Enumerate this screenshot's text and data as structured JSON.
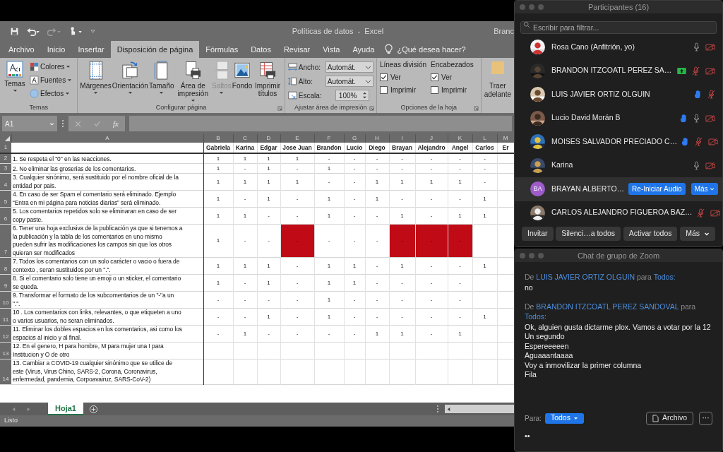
{
  "excel": {
    "title": "Políticas de datos  -  Excel",
    "user": "Branc",
    "tabs": [
      {
        "label": "Archivo",
        "selected": false
      },
      {
        "label": "Inicio",
        "selected": false
      },
      {
        "label": "Insertar",
        "selected": false
      },
      {
        "label": "Disposición de página",
        "selected": true
      },
      {
        "label": "Fórmulas",
        "selected": false
      },
      {
        "label": "Datos",
        "selected": false
      },
      {
        "label": "Revisar",
        "selected": false
      },
      {
        "label": "Vista",
        "selected": false
      },
      {
        "label": "Ayuda",
        "selected": false
      }
    ],
    "tell_me": "¿Qué desea hacer?",
    "ribbon": [
      {
        "kind": "themes",
        "label": "Temas",
        "big": "Temas",
        "items": [
          "Colores",
          "Fuentes",
          "Efectos"
        ]
      },
      {
        "kind": "buttons",
        "label": "Configurar página",
        "buttons": [
          {
            "label": "Márgenes",
            "dropdown": true,
            "disabled": false
          },
          {
            "label": "Orientación",
            "dropdown": true,
            "disabled": false
          },
          {
            "label": "Tamaño",
            "dropdown": true,
            "disabled": false
          },
          {
            "label": "Área de impresión",
            "dropdown": true,
            "disabled": false
          },
          {
            "label": "Saltos",
            "dropdown": true,
            "disabled": true
          },
          {
            "label": "Fondo",
            "dropdown": false,
            "disabled": false
          },
          {
            "label": "Imprimir títulos",
            "dropdown": false,
            "disabled": false
          }
        ]
      },
      {
        "kind": "scale",
        "label": "Ajustar área de impresión",
        "fields": [
          {
            "label": "Ancho:",
            "value": "Automát.",
            "kind": "dropdown"
          },
          {
            "label": "Alto:",
            "value": "Automát.",
            "kind": "dropdown"
          },
          {
            "label": "Escala:",
            "value": "100%",
            "kind": "spinner"
          }
        ]
      },
      {
        "kind": "options",
        "label": "Opciones de la hoja",
        "columns": [
          {
            "title": "Líneas división",
            "checks": [
              {
                "label": "Ver",
                "checked": true
              },
              {
                "label": "Imprimir",
                "checked": false
              }
            ]
          },
          {
            "title": "Encabezados",
            "checks": [
              {
                "label": "Ver",
                "checked": true
              },
              {
                "label": "Imprimir",
                "checked": false
              }
            ]
          }
        ]
      },
      {
        "kind": "single",
        "lines": [
          "Traer",
          "adelante"
        ]
      }
    ],
    "name_box": "A1",
    "formula_label": "fx",
    "table": {
      "corner_row": "1",
      "column_a": "A",
      "columns": [
        {
          "letter": "B",
          "name": "Gabriela"
        },
        {
          "letter": "C",
          "name": "Karina"
        },
        {
          "letter": "D",
          "name": "Edgar"
        },
        {
          "letter": "E",
          "name": "Jose Juan"
        },
        {
          "letter": "F",
          "name": "Brandon"
        },
        {
          "letter": "G",
          "name": "Lucio"
        },
        {
          "letter": "H",
          "name": "Diego"
        },
        {
          "letter": "I",
          "name": "Brayan"
        },
        {
          "letter": "J",
          "name": "Alejandro"
        },
        {
          "letter": "K",
          "name": "Angel"
        },
        {
          "letter": "L",
          "name": "Carlos"
        },
        {
          "letter": "M",
          "name": "Er"
        }
      ],
      "rows": [
        {
          "number": "2",
          "rule": [
            "1. Se respeta el \"0\" en las reacciones."
          ],
          "cells": [
            "1",
            "1",
            "1",
            "1",
            "-",
            "-",
            "-",
            "-",
            "-",
            "-",
            "-"
          ]
        },
        {
          "number": "3",
          "rule": [
            "2. No eliminar las groserias de los comentarios."
          ],
          "cells": [
            "1",
            "-",
            "1",
            "-",
            "1",
            "-",
            "-",
            "-",
            "-",
            "-",
            "-"
          ]
        },
        {
          "number": "4",
          "rule": [
            "3. Cualquier sinónimo, será sustituido por el nombre oficial de la",
            "entidad por pais."
          ],
          "cells": [
            "1",
            "1",
            "1",
            "1",
            "-",
            "-",
            "1",
            "1",
            "1",
            "1",
            "-"
          ]
        },
        {
          "number": "5",
          "rule": [
            "4. En caso de ser Spam el comentario será eliminado. Ejemplo",
            "“Entra en mi página para noticias diarias” será eliminado."
          ],
          "cells": [
            "1",
            "-",
            "1",
            "-",
            "1",
            "-",
            "1",
            "-",
            "-",
            "-",
            "1"
          ]
        },
        {
          "number": "6",
          "rule": [
            "5. Los comentarios repetidos solo se eliminaran en caso de ser",
            "copy paste."
          ],
          "cells": [
            "1",
            "1",
            "-",
            "-",
            "1",
            "-",
            "-",
            "1",
            "-",
            "1",
            "1"
          ]
        },
        {
          "number": "7",
          "rule": [
            "6. Tener una hoja exclusiva de la publicación ya que si tenemos a",
            "la publicación y la tabla de los comentarios en uno mismo",
            "pueden sufrir las modificaciones los campos sin que los otros",
            "quieran ser modificados"
          ],
          "cells": [
            "1",
            "-",
            "-",
            "-",
            "-",
            "-",
            "-",
            "-",
            "-",
            "-",
            null
          ],
          "highlighted": [
            false,
            false,
            false,
            true,
            false,
            false,
            false,
            true,
            true,
            true,
            false
          ]
        },
        {
          "number": "8",
          "rule": [
            "7. Todos los comentarios con un solo carácter o vacio o fuera de",
            "contexto , seran sustituidos por un \".\"."
          ],
          "cells": [
            "1",
            "1",
            "1",
            "-",
            "1",
            "1",
            "-",
            "1",
            "-",
            "-",
            "1"
          ]
        },
        {
          "number": "9",
          "rule": [
            "8. Si el comentario solo tiene un emoji o un sticker, el comentario",
            "se queda."
          ],
          "cells": [
            "1",
            "-",
            "1",
            "-",
            "1",
            "1",
            "-",
            "-",
            "-",
            "-",
            null
          ]
        },
        {
          "number": "10",
          "rule": [
            "9. Transformar el formato de los subcomentarios de un \"-\"a un",
            "\".\"."
          ],
          "cells": [
            "-",
            "-",
            "-",
            "-",
            "1",
            "-",
            "-",
            "-",
            "-",
            "-",
            null
          ]
        },
        {
          "number": "11",
          "rule": [
            "10 . Los comentarios con links, relevantes,  o que etiqueten a uno",
            "o varios  usuarios, no seran eliminados."
          ],
          "cells": [
            "-",
            "-",
            "1",
            "-",
            "1",
            "-",
            "-",
            "-",
            "-",
            "-",
            "1"
          ]
        },
        {
          "number": "12",
          "rule": [
            "11. Eliminar los dobles espacios en los comentarios, asi como los",
            "espacios al inicio y al final."
          ],
          "cells": [
            "-",
            "1",
            "-",
            "-",
            "-",
            "-",
            "1",
            "1",
            "-",
            "1",
            null
          ]
        },
        {
          "number": "13",
          "rule": [
            "12. En el genero, H para hombre, M para mujer una I para",
            "Institucion y O de otro"
          ]
        },
        {
          "number": "14",
          "rule": [
            "13. Cambiar a COVID-19 cualquier sinónimo que se utilice de",
            "este (Virus, Virus Chino, SARS-2, Corona, Coronavirus,",
            "enfermedad, pandemia, Corpoavairuz, SARS-CoV-2)"
          ]
        }
      ]
    },
    "sheets": [
      {
        "label": "Hoja1",
        "selected": true
      }
    ],
    "status": "Listo"
  },
  "participants": {
    "title": "Participantes (16)",
    "search": {
      "placeholder": "Escribir para filtrar..."
    },
    "items": [
      {
        "name": "Rosa Cano (Anfitrión, yo)",
        "sharing": false,
        "hand": false,
        "muted": false,
        "video_off": true,
        "selected": false
      },
      {
        "name": "BRANDON ITZCOATL PEREZ SA…",
        "sharing": true,
        "hand": false,
        "muted": true,
        "video_off": true,
        "selected": false
      },
      {
        "name": "LUIS JAVIER ORTIZ OLGUIN",
        "sharing": false,
        "hand": true,
        "muted": true,
        "video_off": false,
        "selected": false
      },
      {
        "name": "Lucio David Morán B",
        "sharing": false,
        "hand": true,
        "muted": false,
        "video_off": true,
        "selected": false
      },
      {
        "name": "MOISES SALVADOR PRECIADO C…",
        "sharing": false,
        "hand": true,
        "muted": true,
        "video_off": true,
        "selected": false
      },
      {
        "name": "Karina",
        "sharing": false,
        "hand": false,
        "muted": false,
        "video_off": true,
        "selected": false
      },
      {
        "name": "BRAYAN ALBERTO…",
        "avatar": {
          "kind": "initials",
          "initials": "BA",
          "color": "#9d5cc9"
        },
        "sharing": false,
        "hand": false,
        "selected": true,
        "actions": [
          "Re-Iniciar Audio",
          "Más"
        ]
      },
      {
        "name": "CARLOS ALEJANDRO FIGUEROA BAZ…",
        "sharing": false,
        "hand": false,
        "muted": true,
        "video_off": true,
        "selected": false
      }
    ],
    "buttons": [
      "Invitar",
      "Silenci…a todos",
      "Activar todos",
      "Más"
    ]
  },
  "chat": {
    "title": "Chat de grupo de Zoom",
    "messages": [
      {
        "prefix": "De",
        "sender": "LUIS JAVIER ORTIZ OLGUIN",
        "joiner": "para",
        "recipient": "Todos:",
        "lines": [
          "no"
        ]
      },
      {
        "prefix": "De",
        "sender": "BRANDON ITZCOATL PEREZ SANDOVAL",
        "joiner": "para",
        "recipient": "Todos:",
        "lines": [
          "Ok, alguien gusta dictarme plox. Vamos a votar por la 12",
          "Un segundo",
          "Espereeeeen",
          "Aguaaantaaaa",
          "Voy a inmovilizar la primer columna",
          "Fila"
        ]
      }
    ],
    "to_label": "Para:",
    "to_value": "Todos",
    "file_button": "Archivo",
    "more_button": "···",
    "input_value": "••"
  }
}
